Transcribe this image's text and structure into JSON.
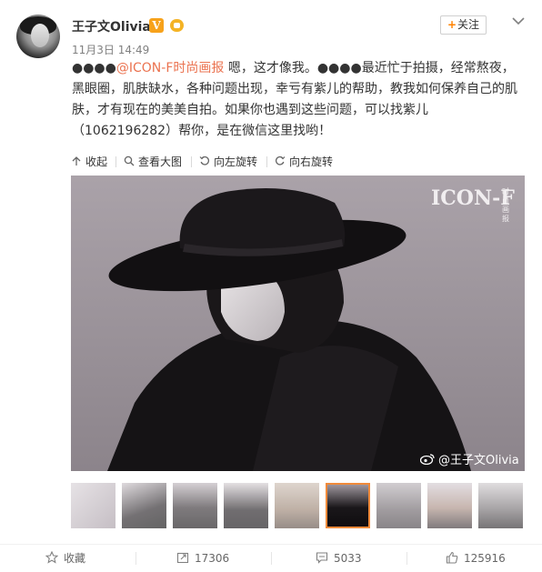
{
  "user": {
    "name": "王子文Olivia",
    "verified_badge": "V",
    "post_time": "11月3日 14:49"
  },
  "header": {
    "follow_label": "关注",
    "follow_plus": "+",
    "more_icon": "chevron-down-icon"
  },
  "post": {
    "segments": [
      "●●●●",
      "@ICON-F时尚画报",
      " 嗯，这才像我。●●●●最近忙于拍摄，经常熬夜，黑眼圈，肌肤缺水，各种问题出现，幸亏有紫儿的帮助，教我如何保养自己的肌肤，才有现在的美美自拍。如果你也遇到这些问题，可以找紫儿（1062196282）帮你，是在微信这里找哟！"
    ]
  },
  "toolbar": {
    "collapse": "收起",
    "view_large": "查看大图",
    "rotate_left": "向左旋转",
    "rotate_right": "向右旋转"
  },
  "image": {
    "magazine_logo": "ICON-F",
    "magazine_sub": "时尚画报",
    "watermark": "@王子文Olivia"
  },
  "thumbnails": {
    "count": 9,
    "selected_index": 5
  },
  "actions": {
    "favorite": "收藏",
    "repost_count": "17306",
    "comment_count": "5033",
    "like_count": "125916"
  },
  "colors": {
    "accent_orange": "#ff8200",
    "mention": "#eb7350",
    "verified": "#f7a21b",
    "selected_border": "#f08a3a"
  }
}
